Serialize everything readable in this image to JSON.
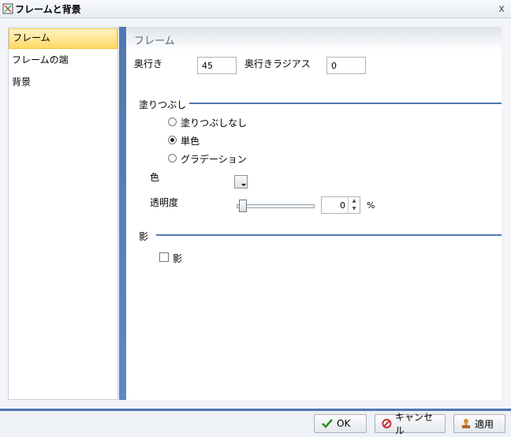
{
  "window": {
    "title": "フレームと背景",
    "close_glyph": "x"
  },
  "sidebar": {
    "items": [
      {
        "label": "フレーム",
        "active": true
      },
      {
        "label": "フレームの端",
        "active": false
      },
      {
        "label": "背景",
        "active": false
      }
    ]
  },
  "content": {
    "header_title": "フレーム",
    "depth": {
      "label": "奥行き",
      "value": "45"
    },
    "depth_radius": {
      "label": "奥行きラジアス",
      "value": "0"
    },
    "fill": {
      "section_label": "塗りつぶし",
      "options": [
        {
          "label": "塗りつぶしなし",
          "selected": false
        },
        {
          "label": "単色",
          "selected": true
        },
        {
          "label": "グラデーション",
          "selected": false
        }
      ],
      "color_label": "色",
      "transparency_label": "透明度",
      "transparency_value": "0",
      "transparency_unit": "%"
    },
    "shadow": {
      "section_label": "影",
      "checkbox_label": "影",
      "checked": false
    }
  },
  "footer": {
    "ok_label": "OK",
    "cancel_label": "キャンセル",
    "apply_label": "適用"
  },
  "colors": {
    "accent": "#4f78b0",
    "selected_nav": "#ffd966",
    "ok_check": "#2e8b2e",
    "cancel_icon": "#c62828"
  }
}
